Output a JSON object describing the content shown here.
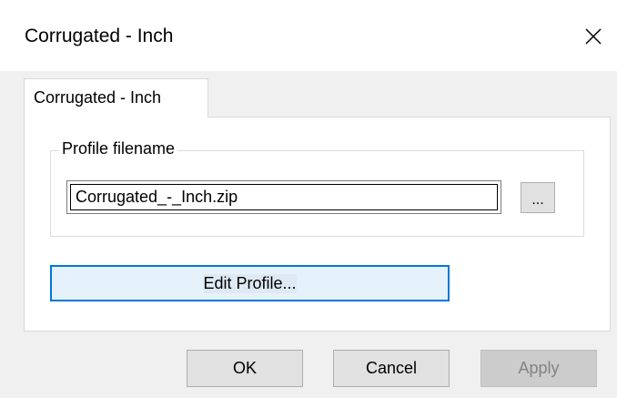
{
  "window": {
    "title": "Corrugated - Inch",
    "close_icon": "close-icon"
  },
  "tabs": [
    {
      "label": "Corrugated - Inch",
      "selected": true
    }
  ],
  "profile_group": {
    "label": "Profile filename",
    "filename_value": "Corrugated_-_Inch.zip",
    "browse_label": "..."
  },
  "edit_button": {
    "label": "Edit Profile..."
  },
  "footer": {
    "ok_label": "OK",
    "cancel_label": "Cancel",
    "apply_label": "Apply",
    "apply_enabled": false
  },
  "colors": {
    "focus_border": "#0078d7",
    "button_face": "#e1e1e1",
    "dialog_bg": "#f0f0f0"
  }
}
